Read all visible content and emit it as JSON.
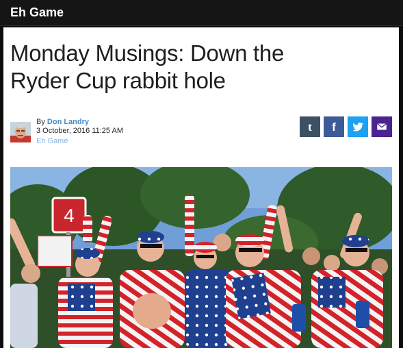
{
  "header": {
    "site_name": "Eh Game"
  },
  "article": {
    "title_line1": "Monday Musings: Down the",
    "title_line2": "Ryder Cup rabbit hole",
    "by_prefix": "By",
    "author": "Don Landry",
    "date": "3 October, 2016 11:25 AM",
    "category": "Eh Game"
  },
  "share_buttons": [
    {
      "network": "tumblr",
      "icon": "tumblr-icon",
      "glyph": "t",
      "color": "#3c5264"
    },
    {
      "network": "facebook",
      "icon": "facebook-icon",
      "glyph": "f",
      "color": "#3e5b98"
    },
    {
      "network": "twitter",
      "icon": "twitter-icon",
      "color": "#1da1f2"
    },
    {
      "network": "email",
      "icon": "email-icon",
      "color": "#4b2490"
    }
  ],
  "hero_image": {
    "hole_sign_number": "4",
    "colors": {
      "sky": "#6f9fd6",
      "trees": "#2f5a2a",
      "stripe_red": "#d2232a",
      "flag_blue": "#1f3f8f"
    }
  }
}
